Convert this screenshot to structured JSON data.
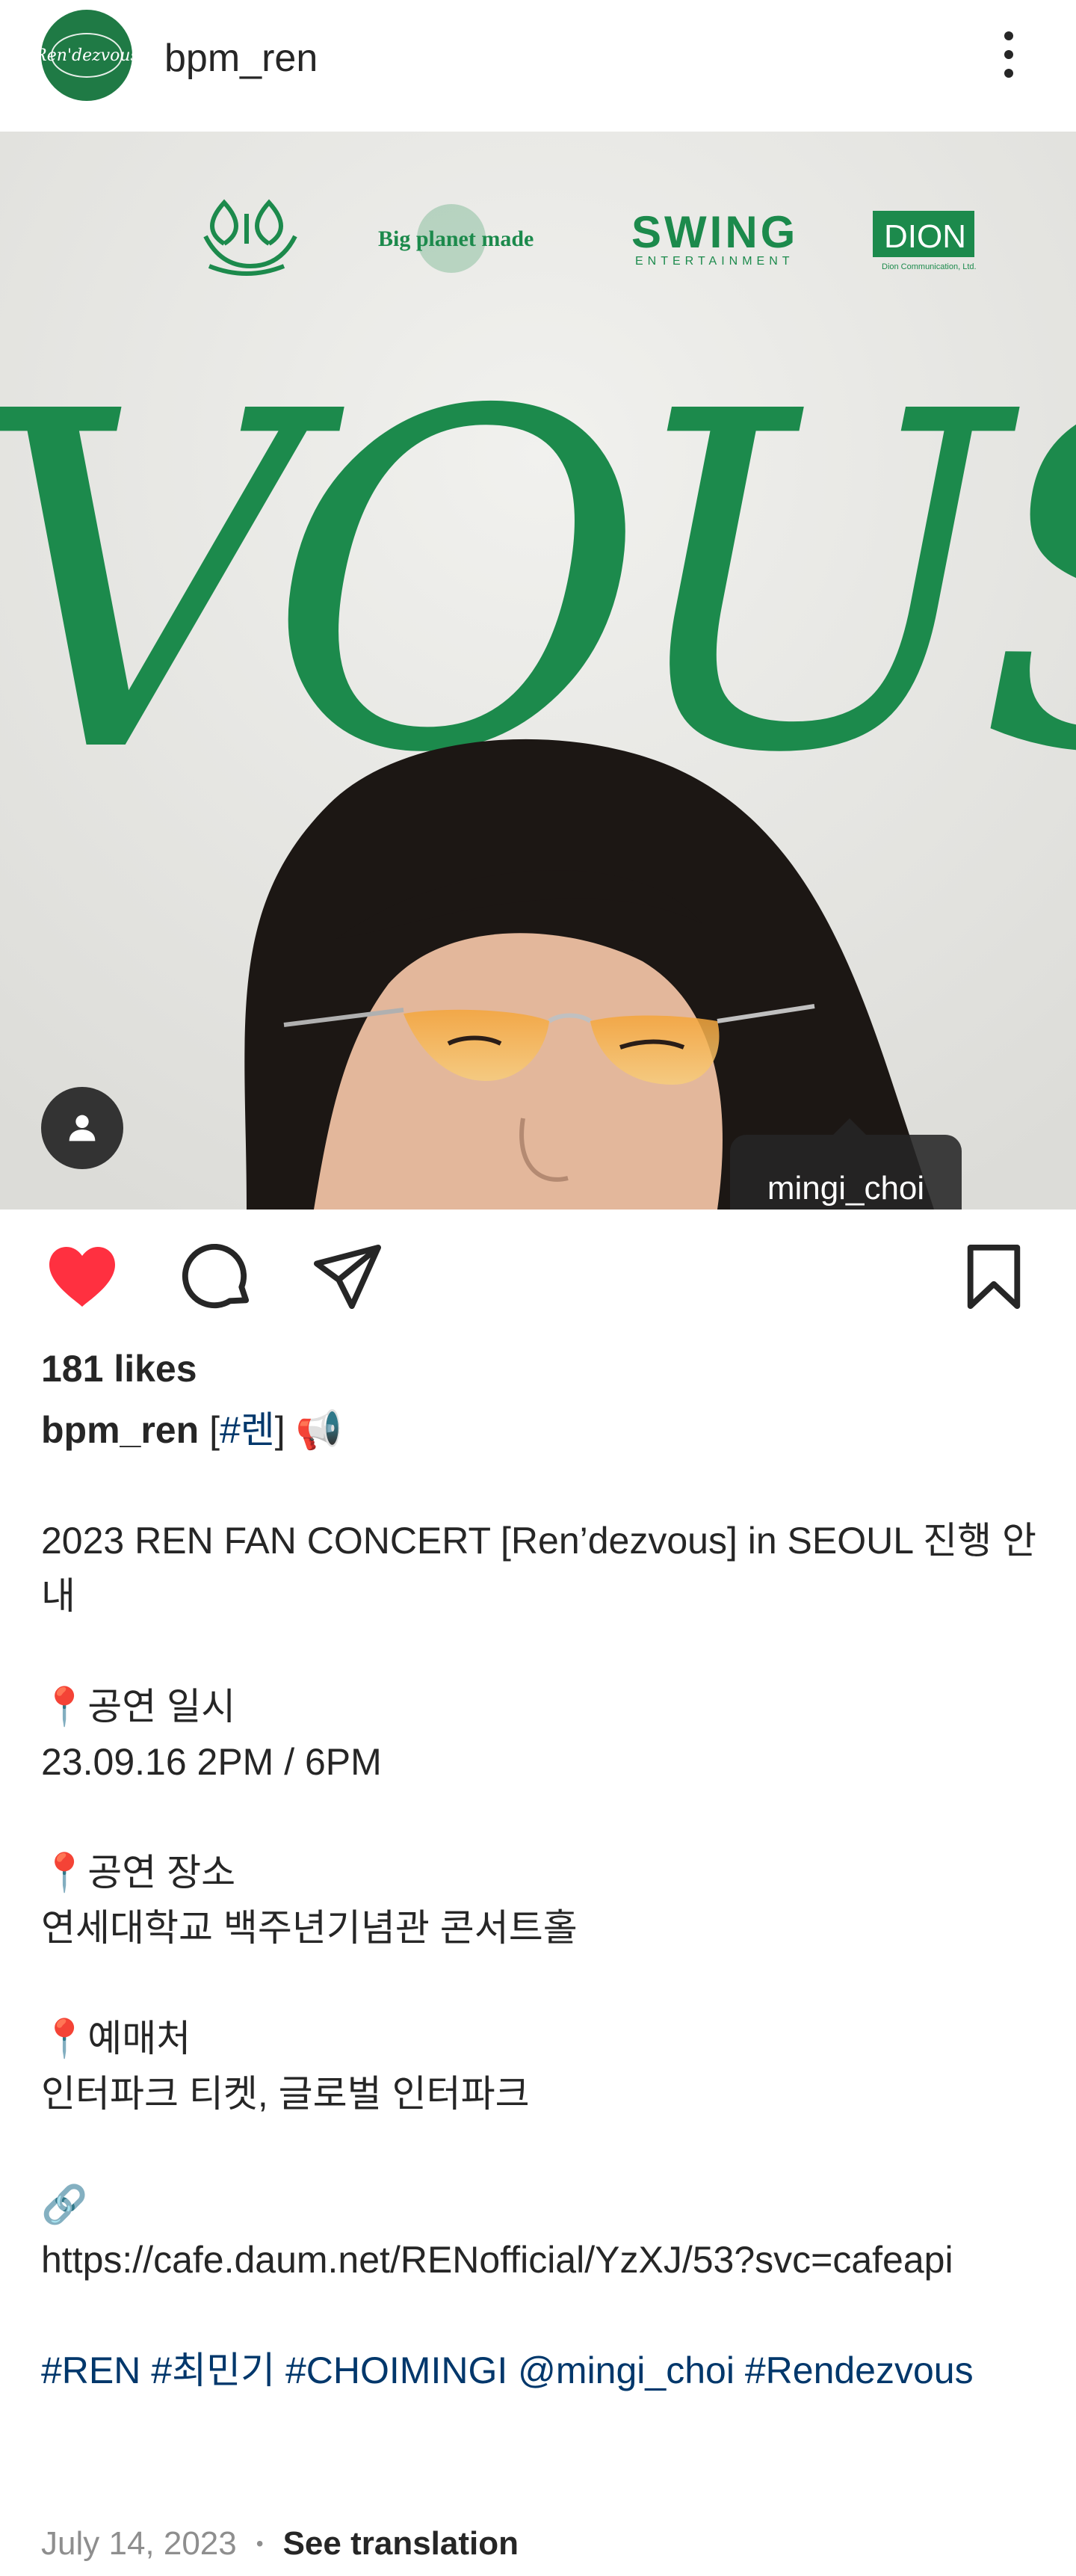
{
  "header": {
    "username": "bpm_ren",
    "avatar_text": "Ren'dezvous",
    "more_icon": "more-vertical-icon"
  },
  "post_image": {
    "logos": [
      "Big planet made",
      "SWING",
      "ENTERTAINMENT",
      "DION",
      "Dion Communication, Ltd."
    ],
    "big_text": "VOUS",
    "tag_username": "mingi_choi",
    "brand_color": "#1c8a4c"
  },
  "actions": {
    "like_icon": "heart-filled-icon",
    "comment_icon": "comment-icon",
    "share_icon": "send-icon",
    "save_icon": "bookmark-icon",
    "like_color": "#ff3040"
  },
  "likes": "181 likes",
  "caption": {
    "username": "bpm_ren",
    "title_open": " [",
    "hashtag_ren": "#렌",
    "title_close": "] 📢",
    "line1": "2023 REN FAN CONCERT [Ren’dezvous] in SEOUL 진행 안내",
    "date_heading": "📍공연 일시",
    "date_value": "23.09.16 2PM / 6PM",
    "venue_heading": "📍공연 장소",
    "venue_value": "연세대학교 백주년기념관 콘서트홀",
    "tickets_heading": "📍예매처",
    "tickets_value": "인터파크 티켓, 글로벌 인터파크",
    "link_emoji": "🔗",
    "link_url": "https://cafe.daum.net/RENofficial/YzXJ/53?svc=cafeapi",
    "tags": [
      "#REN",
      "#최민기",
      "#CHOIMINGI",
      "@mingi_choi",
      "#Rendezvous"
    ]
  },
  "footer": {
    "date": "July 14, 2023",
    "separator": "•",
    "translate": "See translation"
  }
}
